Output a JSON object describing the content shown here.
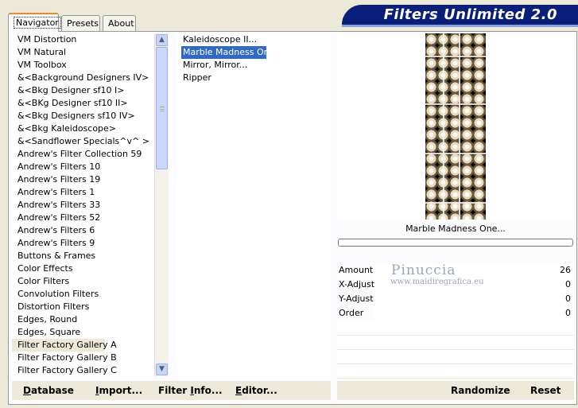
{
  "tabs": [
    {
      "label": "Navigator"
    },
    {
      "label": "Presets"
    },
    {
      "label": "About"
    }
  ],
  "header": {
    "title": "Filters Unlimited 2.0"
  },
  "categories": [
    "VM Distortion",
    "VM Natural",
    "VM Toolbox",
    "&<Background Designers IV>",
    "&<Bkg Designer sf10 I>",
    "&<BKg Designer sf10 II>",
    "&<Bkg Designers sf10 IV>",
    "&<Bkg Kaleidoscope>",
    "&<Sandflower Specials^v^ >",
    "Andrew's Filter Collection 59",
    "Andrew's Filters 10",
    "Andrew's Filters 19",
    "Andrew's Filters 1",
    "Andrew's Filters 33",
    "Andrew's Filters 52",
    "Andrew's Filters 6",
    "Andrew's Filters 9",
    "Buttons & Frames",
    "Color Effects",
    "Color Filters",
    "Convolution Filters",
    "Distortion Filters",
    "Edges, Round",
    "Edges, Square",
    "Filter Factory Gallery A",
    "Filter Factory Gallery B",
    "Filter Factory Gallery C"
  ],
  "selected_category": "Filter Factory Gallery A",
  "filters": [
    "Kaleidoscope II...",
    "Marble Madness One...",
    "Mirror, Mirror...",
    "Ripper"
  ],
  "selected_filter": "Marble Madness One...",
  "preview": {
    "caption": "Marble Madness One..."
  },
  "params": [
    {
      "name": "Amount",
      "value": "26"
    },
    {
      "name": "X-Adjust",
      "value": "0"
    },
    {
      "name": "Y-Adjust",
      "value": "0"
    },
    {
      "name": "Order",
      "value": "0"
    }
  ],
  "watermark": {
    "name": "Pinuccia",
    "url": "www.maidiregrafica.eu"
  },
  "buttons": {
    "database": {
      "first": "D",
      "rest": "atabase"
    },
    "import": {
      "first": "I",
      "rest": "mport..."
    },
    "filter_info": {
      "first": "Filter ",
      "mid": "I",
      "rest": "nfo..."
    },
    "editor": {
      "first": "E",
      "rest": "ditor..."
    },
    "randomize": "Randomize",
    "reset": "Reset"
  },
  "colors": {
    "banner": "#0a1f7a",
    "selection": "#316ac5",
    "tab_highlight": "#e68b2c"
  }
}
